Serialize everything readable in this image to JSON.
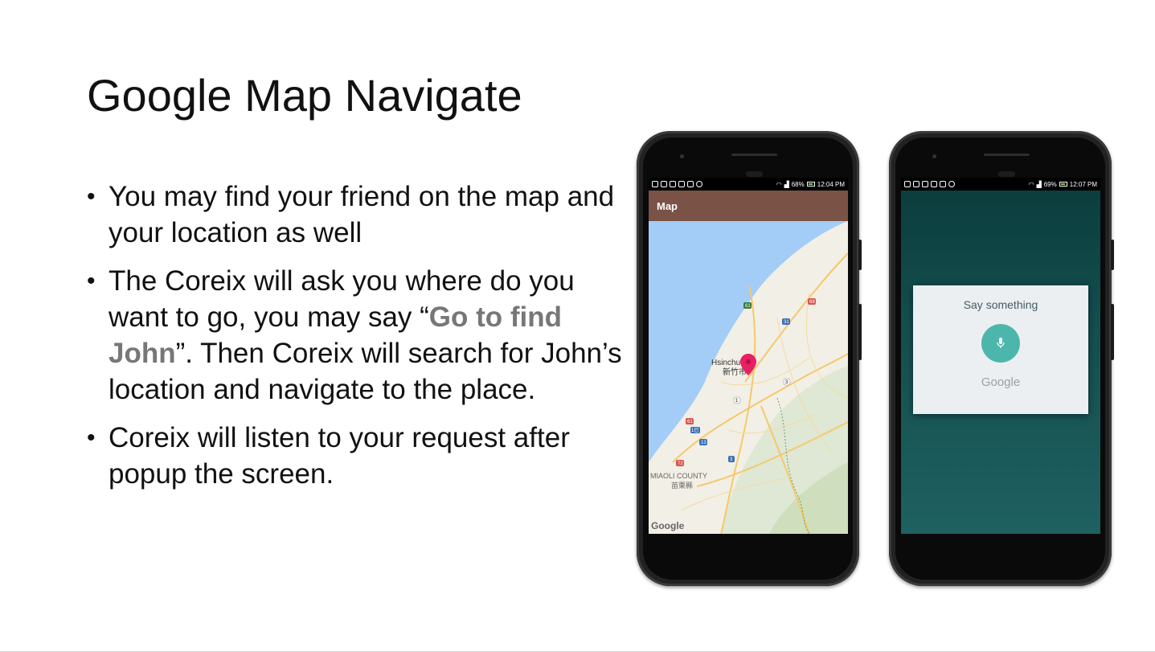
{
  "slide": {
    "title": "Google Map Navigate",
    "bullets": [
      {
        "parts": [
          "You may find your friend on the map and your location as well"
        ]
      },
      {
        "parts": [
          "The Coreix will ask you where do you want to go, you may say “",
          "Go to find John",
          "”. Then Coreix will search for John’s location and navigate to the place."
        ]
      },
      {
        "parts": [
          "Coreix will listen to your request after popup the screen."
        ]
      }
    ]
  },
  "phone_left": {
    "status": {
      "battery": "68%",
      "time": "12:04 PM"
    },
    "appbar_title": "Map",
    "map": {
      "city_label": "Hsinchu City",
      "city_label_cn": "新竹市",
      "county_label": "MIAOLI COUNTY",
      "county_label_cn": "苗栗縣",
      "logo": "Google",
      "route_numbers": [
        "61",
        "68",
        "31",
        "1",
        "3",
        "61",
        "1已",
        "13",
        "72",
        "3"
      ]
    }
  },
  "phone_right": {
    "status": {
      "battery": "69%",
      "time": "12:07 PM"
    },
    "dialog": {
      "prompt": "Say something",
      "logo": "Google"
    }
  },
  "colors": {
    "appbar": "#7a5246",
    "mic": "#4db6ac",
    "pin": "#e91e63",
    "water": "#a3cdf6",
    "land": "#f2efe6"
  }
}
